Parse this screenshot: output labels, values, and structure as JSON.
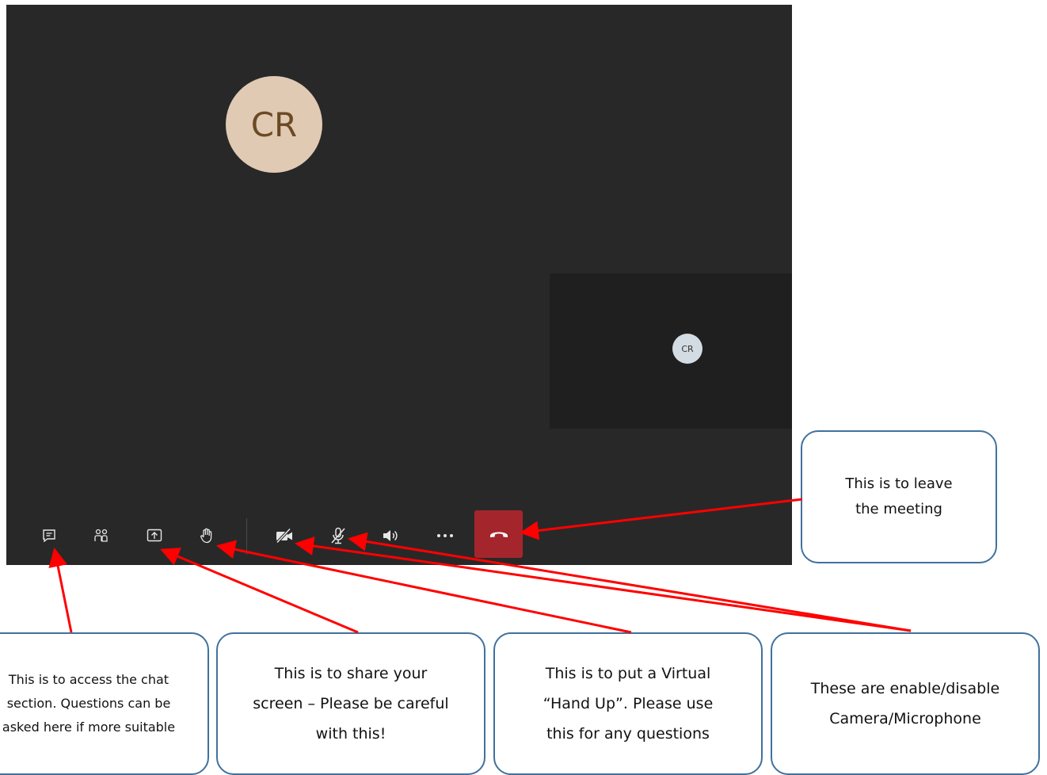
{
  "meeting": {
    "participant_initials": "CR",
    "self_initials": "CR"
  },
  "toolbar": {
    "buttons": [
      {
        "name": "chat",
        "icon": "chat-icon"
      },
      {
        "name": "participants",
        "icon": "people-icon"
      },
      {
        "name": "share",
        "icon": "share-screen-icon"
      },
      {
        "name": "raise-hand",
        "icon": "hand-icon"
      },
      {
        "name": "camera",
        "icon": "camera-off-icon"
      },
      {
        "name": "microphone",
        "icon": "mic-off-icon"
      },
      {
        "name": "speaker",
        "icon": "speaker-icon"
      },
      {
        "name": "more",
        "icon": "more-icon"
      },
      {
        "name": "leave",
        "icon": "hang-up-icon"
      }
    ],
    "hangup_color": "#a4262c"
  },
  "callouts": {
    "chat": "This is to access the chat\nsection. Questions can be\nasked here if more suitable",
    "share": "This is to share your\nscreen – Please be careful\nwith this!",
    "hand": "This is to put a Virtual\n“Hand Up”. Please use\nthis for any questions",
    "camera_mic": "These are enable/disable\nCamera/Microphone",
    "leave": "This is to leave\nthe meeting"
  },
  "colors": {
    "arrow": "#ff0000",
    "callout_border": "#41719c",
    "meeting_bg": "#292828"
  }
}
